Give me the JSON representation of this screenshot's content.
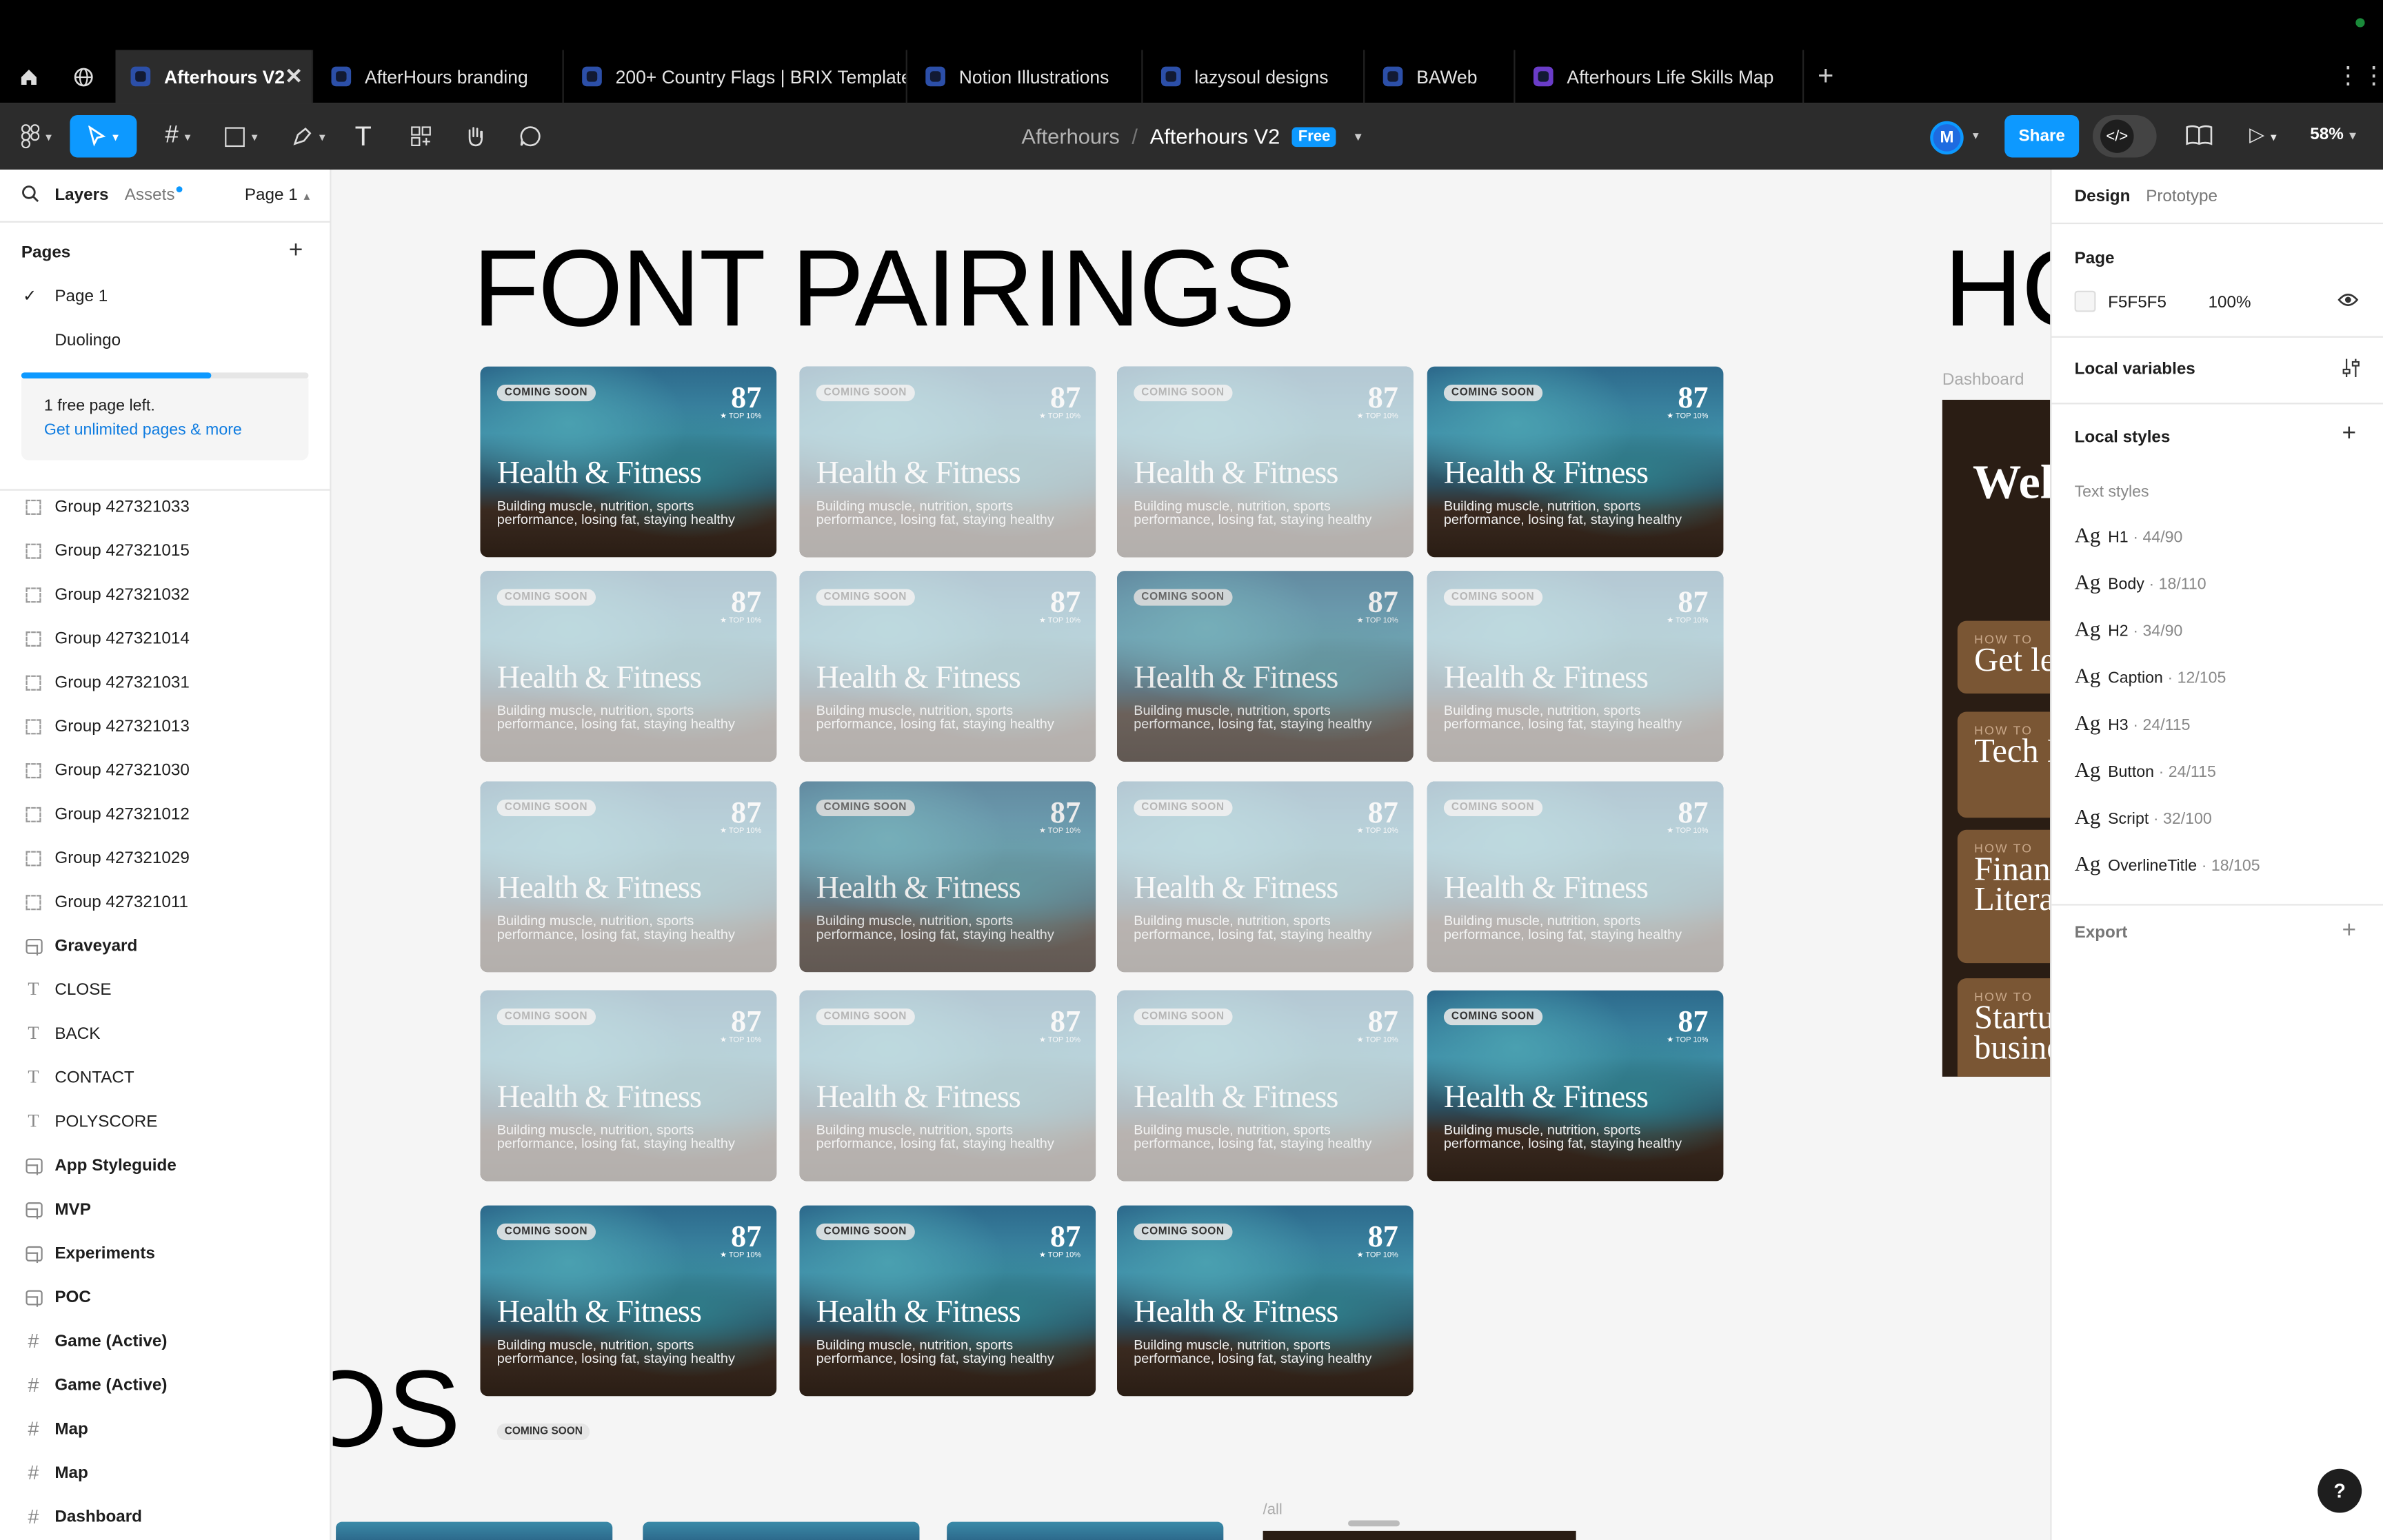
{
  "tabs": [
    {
      "label": "Afterhours V2",
      "active": true
    },
    {
      "label": "AfterHours branding"
    },
    {
      "label": "200+ Country Flags | BRIX Templates"
    },
    {
      "label": "Notion Illustrations"
    },
    {
      "label": "lazysoul designs"
    },
    {
      "label": "BAWeb"
    },
    {
      "label": "Afterhours Life Skills Map"
    }
  ],
  "toolbar": {
    "project": "Afterhours",
    "file": "Afterhours V2",
    "plan_badge": "Free",
    "avatar_initial": "M",
    "share_label": "Share",
    "zoom": "58%"
  },
  "left": {
    "tab_layers": "Layers",
    "tab_assets": "Assets",
    "page_selector": "Page 1",
    "pages_heading": "Pages",
    "pages": [
      {
        "name": "Page 1",
        "current": true
      },
      {
        "name": "Duolingo"
      }
    ],
    "pages_used_fraction": 0.66,
    "upsell_text": "1 free page left.",
    "upsell_link": "Get unlimited pages & more",
    "layers": [
      {
        "name": "Group 427321033",
        "type": "group"
      },
      {
        "name": "Group 427321015",
        "type": "group"
      },
      {
        "name": "Group 427321032",
        "type": "group"
      },
      {
        "name": "Group 427321014",
        "type": "group"
      },
      {
        "name": "Group 427321031",
        "type": "group"
      },
      {
        "name": "Group 427321013",
        "type": "group"
      },
      {
        "name": "Group 427321030",
        "type": "group"
      },
      {
        "name": "Group 427321012",
        "type": "group"
      },
      {
        "name": "Group 427321029",
        "type": "group"
      },
      {
        "name": "Group 427321011",
        "type": "group"
      },
      {
        "name": "Graveyard",
        "type": "section"
      },
      {
        "name": "CLOSE",
        "type": "text"
      },
      {
        "name": "BACK",
        "type": "text"
      },
      {
        "name": "CONTACT",
        "type": "text"
      },
      {
        "name": "POLYSCORE",
        "type": "text"
      },
      {
        "name": "App Styleguide",
        "type": "section"
      },
      {
        "name": "MVP",
        "type": "section"
      },
      {
        "name": "Experiments",
        "type": "section"
      },
      {
        "name": "POC",
        "type": "section"
      },
      {
        "name": "Game (Active)",
        "type": "frame"
      },
      {
        "name": "Game (Active)",
        "type": "frame"
      },
      {
        "name": "Map",
        "type": "frame"
      },
      {
        "name": "Map",
        "type": "frame"
      },
      {
        "name": "Dashboard",
        "type": "frame"
      }
    ]
  },
  "canvas": {
    "heading": "FONT PAIRINGS",
    "heading_right": "HC",
    "heading_bottom": "OS",
    "dashboard_label": "Dashboard",
    "dashboard_welcome": "Wel",
    "dashboard_cards": [
      {
        "how": "HOW TO",
        "title": "Get lea"
      },
      {
        "how": "HOW TO",
        "title": "Tech L"
      },
      {
        "how": "HOW TO",
        "title": "Financ Litera"
      },
      {
        "how": "HOW TO",
        "title": "Startu busine"
      }
    ],
    "card": {
      "badge": "COMING SOON",
      "score": "87",
      "rank": "★ TOP 10%",
      "title": "Health & Fitness",
      "desc": "Building muscle, nutrition, sports performance, losing fat, staying healthy"
    },
    "cards": [
      {
        "state": "full"
      },
      {
        "state": "faded"
      },
      {
        "state": "faded"
      },
      {
        "state": "full"
      },
      {
        "state": "faded"
      },
      {
        "state": "faded"
      },
      {
        "state": "mid"
      },
      {
        "state": "faded"
      },
      {
        "state": "faded"
      },
      {
        "state": "mid"
      },
      {
        "state": "faded"
      },
      {
        "state": "faded"
      },
      {
        "state": "faded"
      },
      {
        "state": "faded"
      },
      {
        "state": "faded"
      },
      {
        "state": "full"
      },
      {
        "state": "full"
      },
      {
        "state": "full"
      },
      {
        "state": "full"
      }
    ],
    "bottom_badge": "COMING SOON",
    "all_label": "/all"
  },
  "right": {
    "tab_design": "Design",
    "tab_prototype": "Prototype",
    "page_heading": "Page",
    "page_color": "F5F5F5",
    "page_opacity": "100%",
    "local_variables": "Local variables",
    "local_styles": "Local styles",
    "text_styles_heading": "Text styles",
    "text_styles": [
      {
        "name": "H1",
        "size": "· 44/90"
      },
      {
        "name": "Body",
        "size": "· 18/110"
      },
      {
        "name": "H2",
        "size": "· 34/90"
      },
      {
        "name": "Caption",
        "size": "· 12/105"
      },
      {
        "name": "H3",
        "size": "· 24/115"
      },
      {
        "name": "Button",
        "size": "· 24/115"
      },
      {
        "name": "Script",
        "size": "· 32/100"
      },
      {
        "name": "OverlineTitle",
        "size": "· 18/105"
      }
    ],
    "export_heading": "Export"
  },
  "help_label": "?"
}
